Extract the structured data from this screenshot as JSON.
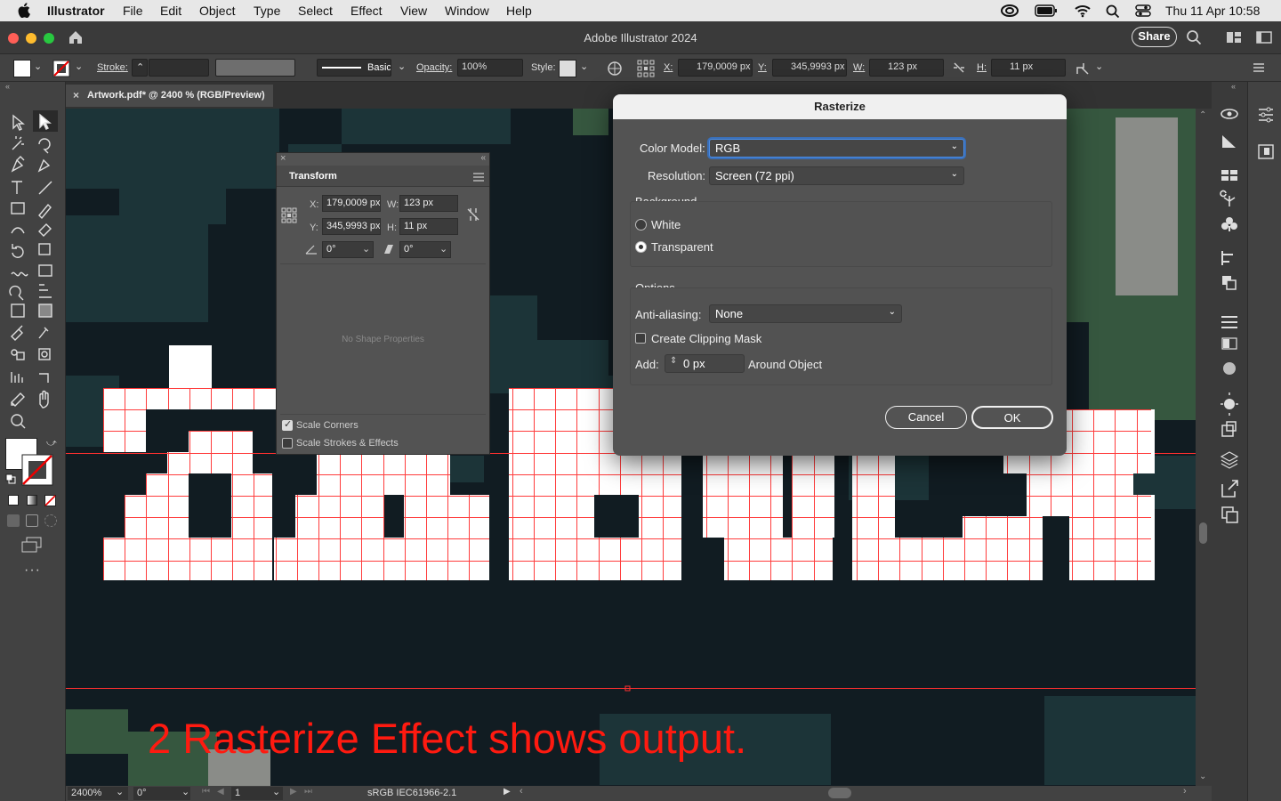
{
  "menubar": {
    "app_name": "Illustrator",
    "items": [
      "File",
      "Edit",
      "Object",
      "Type",
      "Select",
      "Effect",
      "View",
      "Window",
      "Help"
    ],
    "clock": "Thu 11 Apr  10:58"
  },
  "window": {
    "title": "Adobe Illustrator 2024",
    "share_label": "Share"
  },
  "controlbar": {
    "stroke_label": "Stroke:",
    "brush_label": "Basic",
    "opacity_label": "Opacity:",
    "opacity_value": "100%",
    "style_label": "Style:",
    "x_label": "X:",
    "x_value": "179,0009 px",
    "y_label": "Y:",
    "y_value": "345,9993 px",
    "w_label": "W:",
    "w_value": "123 px",
    "h_label": "H:",
    "h_value": "11 px"
  },
  "document_tab": {
    "title": "Artwork.pdf* @ 2400 % (RGB/Preview)"
  },
  "transform_panel": {
    "title": "Transform",
    "x_label": "X:",
    "x_value": "179,0009 px",
    "y_label": "Y:",
    "y_value": "345,9993 px",
    "w_label": "W:",
    "w_value": "123 px",
    "h_label": "H:",
    "h_value": "11 px",
    "angle_value": "0°",
    "shear_value": "0°",
    "empty_text": "No Shape Properties",
    "scale_corners": "Scale Corners",
    "scale_strokes": "Scale Strokes & Effects"
  },
  "rasterize_dialog": {
    "title": "Rasterize",
    "color_model_label": "Color Model:",
    "color_model_value": "RGB",
    "resolution_label": "Resolution:",
    "resolution_value": "Screen (72 ppi)",
    "background_label": "Background",
    "white_label": "White",
    "transparent_label": "Transparent",
    "background_selected": "Transparent",
    "options_label": "Options",
    "antialiasing_label": "Anti-aliasing:",
    "antialiasing_value": "None",
    "clipping_mask_label": "Create Clipping Mask",
    "clipping_mask_checked": false,
    "add_label": "Add:",
    "add_value": "0 px",
    "around_object_label": "Around Object",
    "cancel_label": "Cancel",
    "ok_label": "OK"
  },
  "statusbar": {
    "zoom": "2400%",
    "rotation": "0°",
    "artboard": "1",
    "color_profile": "sRGB IEC61966-2.1"
  },
  "annotation": {
    "caption": "2 Rasterize Effect shows output."
  },
  "colors": {
    "accent": "#4b8ee8",
    "canvas_dark": "#111c22",
    "pixel_green": "#3a5a45",
    "pixel_teal": "#1e3a3e",
    "guide_red": "#ff3030",
    "caption_red": "#ff1a10"
  }
}
